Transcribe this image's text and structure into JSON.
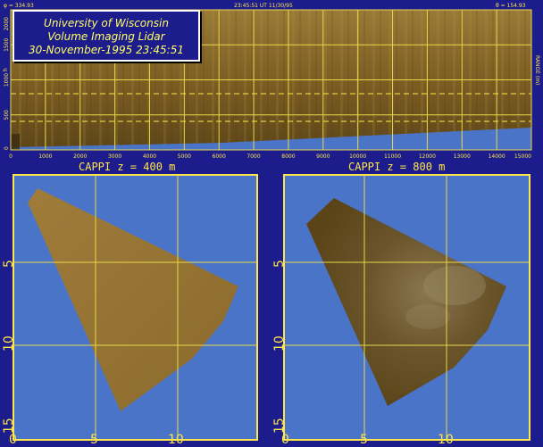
{
  "header": {
    "left_readout": "φ = 334.93",
    "center_readout": "23:45:51 UT 11/30/95",
    "right_readout": "θ = 154.93"
  },
  "title_box": {
    "line1": "University of Wisconsin",
    "line2": "Volume Imaging Lidar",
    "line3": "30-November-1995 23:45:51"
  },
  "rhi_panel": {
    "y_ticks": [
      "0",
      "500",
      "1000",
      "1500",
      "2000"
    ],
    "x_ticks": [
      "0",
      "1000",
      "2000",
      "3000",
      "4000",
      "5000",
      "6000",
      "7000",
      "8000",
      "9000",
      "10000",
      "11000",
      "12000",
      "13000",
      "14000",
      "15000"
    ],
    "y_unit_left": "h",
    "right_axis_label": "RANGE (m)"
  },
  "cappi_left": {
    "title": "CAPPI  z = 400 m",
    "y_ticks": [
      "5",
      "10",
      "15"
    ],
    "x_ticks": [
      "0",
      "5",
      "10"
    ]
  },
  "cappi_right": {
    "title": "CAPPI  z = 800 m",
    "y_ticks": [
      "5",
      "10",
      "15"
    ],
    "x_ticks": [
      "0",
      "5",
      "10"
    ]
  },
  "colors": {
    "frame": "#1c1c8c",
    "sky": "#4a74c8",
    "aerosol": "#8a6a2a",
    "grid": "#e8d84a"
  }
}
